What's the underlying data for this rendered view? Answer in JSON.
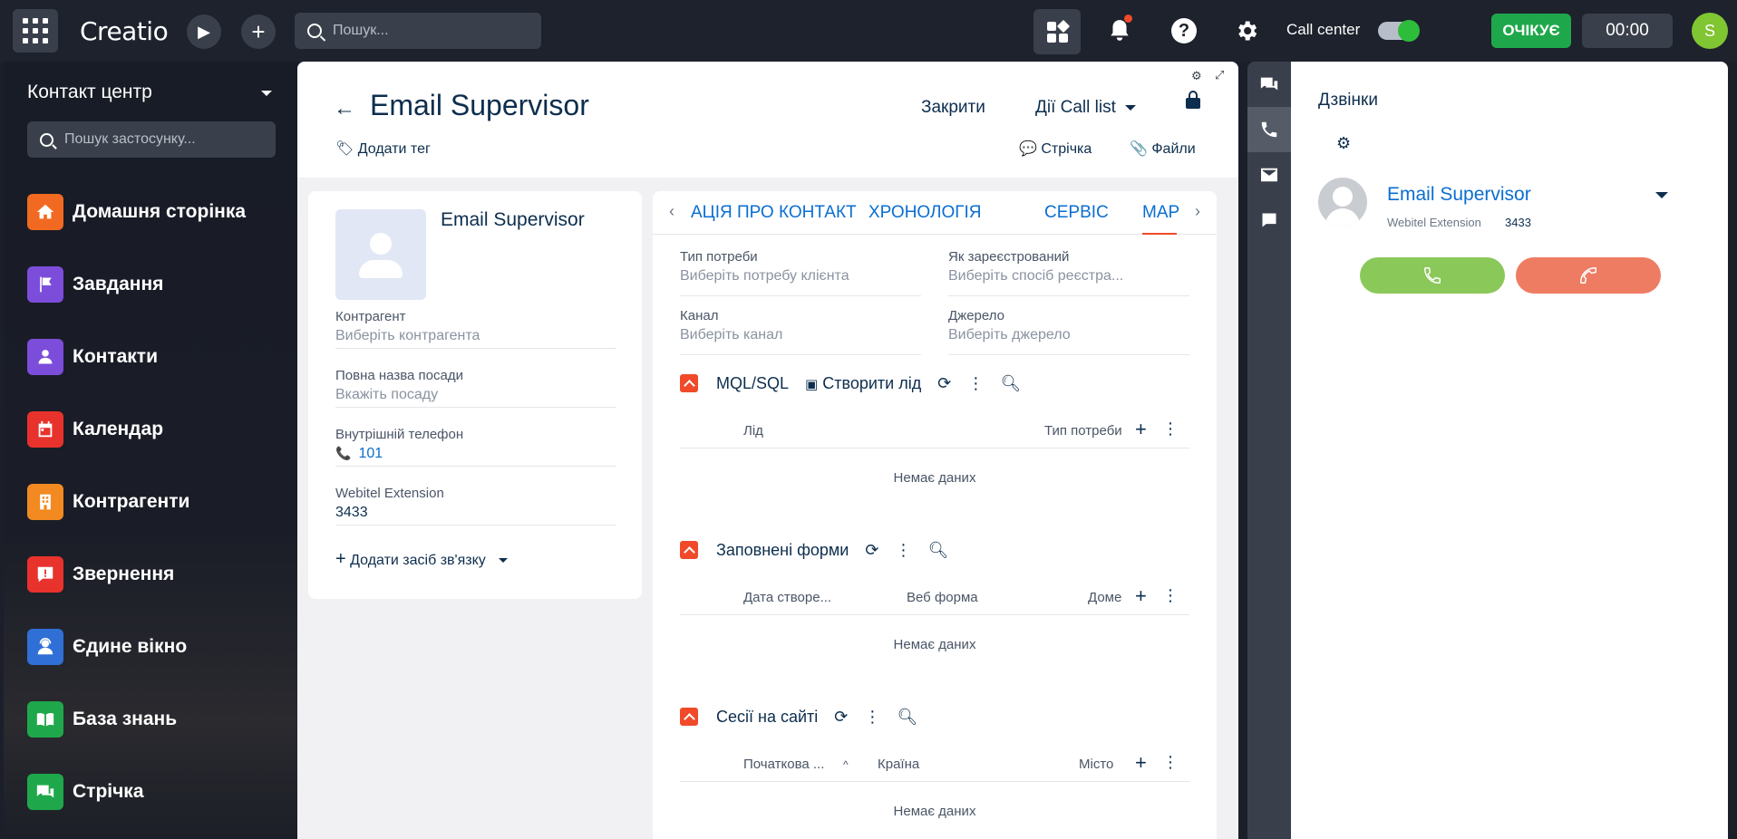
{
  "topbar": {
    "logo": "Creatio",
    "search_placeholder": "Пошук...",
    "call_center_label": "Call center",
    "status_label": "ОЧІКУЄ",
    "timer": "00:00",
    "avatar_letter": "S",
    "colors": {
      "status": "#1fa84b",
      "avatar": "#80c532",
      "accent": "#f04a2a"
    }
  },
  "sidebar": {
    "workspace": "Контакт центр",
    "search_placeholder": "Пошук застосунку...",
    "items": [
      {
        "label": "Домашня сторінка",
        "icon": "home-icon",
        "color": "#f26a21"
      },
      {
        "label": "Завдання",
        "icon": "flag-icon",
        "color": "#7c4ddb"
      },
      {
        "label": "Контакти",
        "icon": "person-icon",
        "color": "#7c4ddb"
      },
      {
        "label": "Календар",
        "icon": "calendar-icon",
        "color": "#e8322c"
      },
      {
        "label": "Контрагенти",
        "icon": "building-icon",
        "color": "#f28a21"
      },
      {
        "label": "Звернення",
        "icon": "alert-message-icon",
        "color": "#e8322c"
      },
      {
        "label": "Єдине вікно",
        "icon": "agent-icon",
        "color": "#2f6fd6"
      },
      {
        "label": "База знань",
        "icon": "book-icon",
        "color": "#1fa84b"
      },
      {
        "label": "Стрічка",
        "icon": "feed-icon",
        "color": "#1fa84b"
      }
    ]
  },
  "page": {
    "title": "Email Supervisor",
    "close_label": "Закрити",
    "actions_label": "Дії Call list",
    "add_tag_label": "Додати тег",
    "feed_label": "Стрічка",
    "files_label": "Файли"
  },
  "profile": {
    "name": "Email Supervisor",
    "fields": [
      {
        "label": "Контрагент",
        "value": "Виберіть контрагента"
      },
      {
        "label": "Повна назва посади",
        "value": "Вкажіть посаду"
      },
      {
        "label": "Внутрішній телефон",
        "value": "101"
      },
      {
        "label": "Webitel Extension",
        "value": "3433"
      }
    ],
    "add_contact_label": "Додати засіб зв'язку"
  },
  "tabs": {
    "items": [
      "АЦІЯ ПРО КОНТАКТ",
      "ХРОНОЛОГІЯ",
      "СЕРВІС",
      "МАР"
    ],
    "fields": [
      {
        "label": "Тип потреби",
        "value": "Виберіть потребу клієнта"
      },
      {
        "label": "Як зареєстрований",
        "value": "Виберіть спосіб реєстра..."
      },
      {
        "label": "Канал",
        "value": "Виберіть канал"
      },
      {
        "label": "Джерело",
        "value": "Виберіть джерело"
      }
    ],
    "sections": [
      {
        "title": "MQL/SQL",
        "action": "Створити лід",
        "columns": [
          "Лід",
          "Тип потреби"
        ],
        "empty": "Немає даних"
      },
      {
        "title": "Заповнені форми",
        "columns": [
          "Дата створе...",
          "Веб форма",
          "Доме"
        ],
        "empty": "Немає даних"
      },
      {
        "title": "Сесії на сайті",
        "columns": [
          "Початкова ...",
          "Країна",
          "Місто"
        ],
        "empty": "Немає даних"
      }
    ]
  },
  "calls": {
    "title": "Дзвінки",
    "caller_name": "Email Supervisor",
    "caller_meta_label": "Webitel Extension",
    "caller_ext": "3433",
    "colors": {
      "answer": "#8bc85a",
      "hangup": "#ee7c63"
    }
  }
}
